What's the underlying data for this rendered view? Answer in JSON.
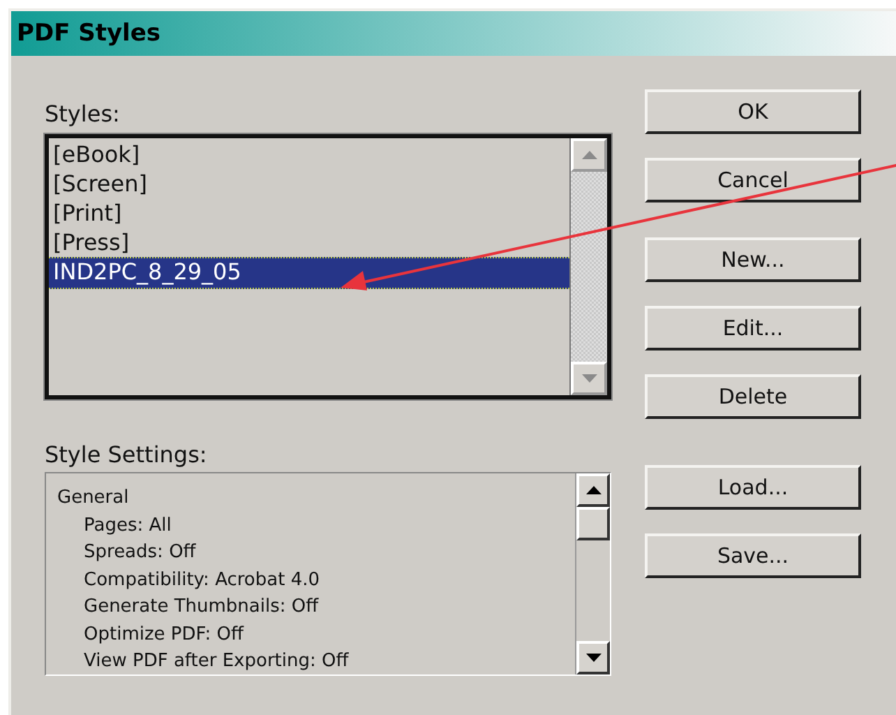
{
  "window": {
    "title": "PDF Styles"
  },
  "styles": {
    "label": "Styles:",
    "items": [
      {
        "label": "[eBook]",
        "selected": false
      },
      {
        "label": "[Screen]",
        "selected": false
      },
      {
        "label": "[Print]",
        "selected": false
      },
      {
        "label": "[Press]",
        "selected": false
      },
      {
        "label": "IND2PC_8_29_05",
        "selected": true
      }
    ]
  },
  "style_settings": {
    "label": "Style Settings:",
    "lines": [
      {
        "text": "General",
        "children": [
          {
            "text": "Pages: All"
          },
          {
            "text": "Spreads: Off"
          },
          {
            "text": "Compatibility: Acrobat 4.0"
          },
          {
            "text": "Generate Thumbnails: Off"
          },
          {
            "text": "Optimize PDF: Off"
          },
          {
            "text": "View PDF after Exporting: Off"
          }
        ]
      }
    ]
  },
  "button_groups": [
    {
      "buttons": [
        {
          "label": "OK"
        },
        {
          "label": "Cancel"
        }
      ]
    },
    {
      "buttons": [
        {
          "label": "New..."
        },
        {
          "label": "Edit..."
        },
        {
          "label": "Delete"
        }
      ]
    },
    {
      "buttons": [
        {
          "label": "Load..."
        },
        {
          "label": "Save..."
        }
      ]
    }
  ]
}
